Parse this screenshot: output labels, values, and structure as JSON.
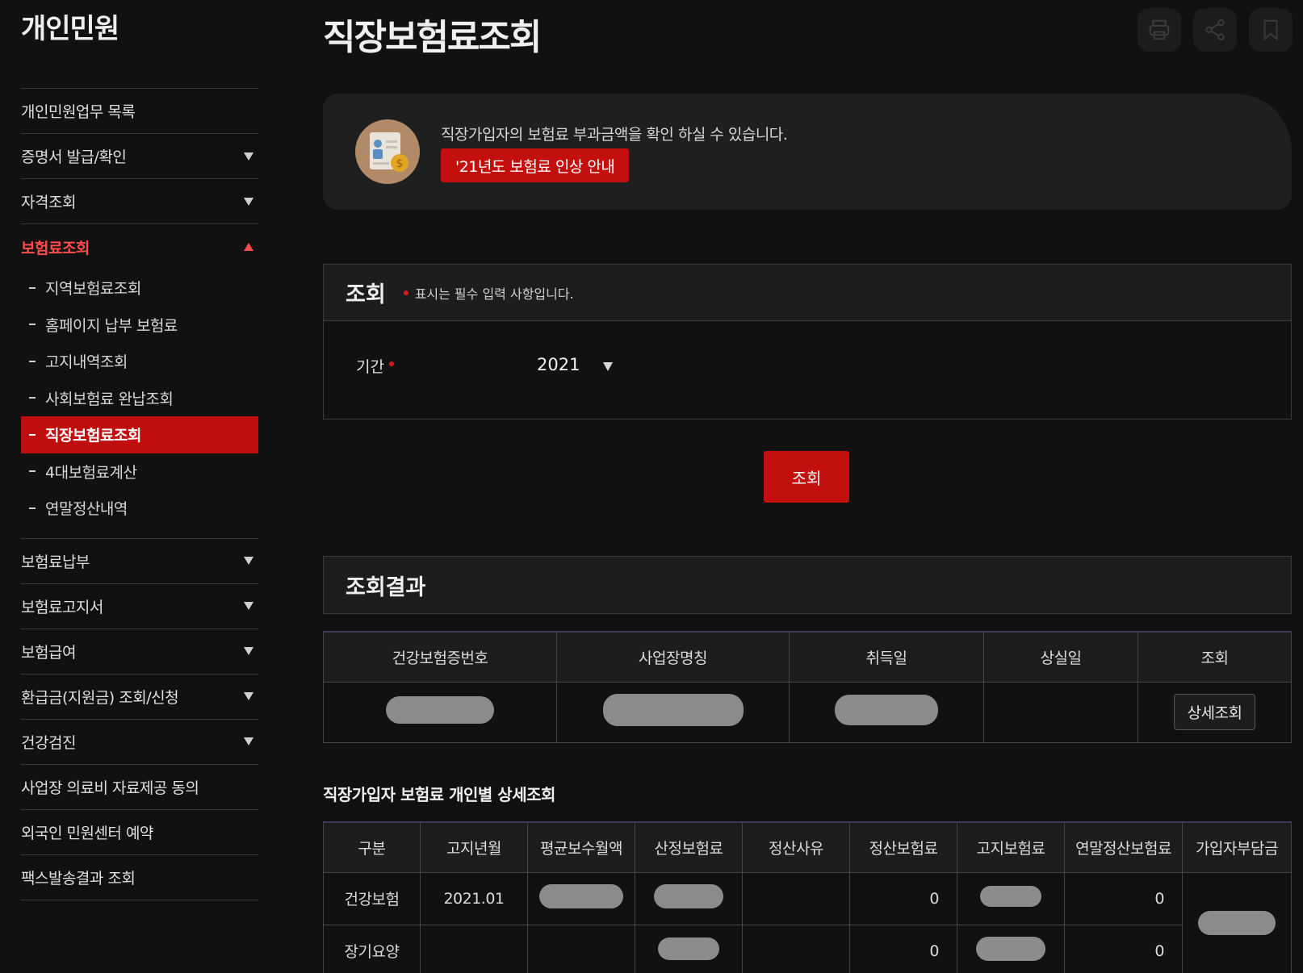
{
  "sidebar": {
    "title": "개인민원",
    "items": [
      {
        "label": "개인민원업무 목록"
      },
      {
        "label": "증명서 발급/확인"
      },
      {
        "label": "자격조회"
      },
      {
        "label": "보험료조회"
      },
      {
        "label": "보험료납부"
      },
      {
        "label": "보험료고지서"
      },
      {
        "label": "보험급여"
      },
      {
        "label": "환급금(지원금) 조회/신청"
      },
      {
        "label": "건강검진"
      },
      {
        "label": "사업장 의료비 자료제공 동의"
      },
      {
        "label": "외국인 민원센터 예약"
      },
      {
        "label": "팩스발송결과 조회"
      }
    ],
    "submenu": [
      {
        "label": "지역보험료조회"
      },
      {
        "label": "홈페이지 납부 보험료"
      },
      {
        "label": "고지내역조회"
      },
      {
        "label": "사회보험료 완납조회"
      },
      {
        "label": "직장보험료조회"
      },
      {
        "label": "4대보험료계산"
      },
      {
        "label": "연말정산내역"
      }
    ]
  },
  "header": {
    "title": "직장보험료조회",
    "tools": [
      "print-icon",
      "share-icon",
      "bookmark-icon"
    ]
  },
  "info": {
    "text": "직장가입자의 보험료 부과금액을 확인 하실 수 있습니다.",
    "button": "'21년도 보험료 인상 안내"
  },
  "query": {
    "title": "조회",
    "note": "표시는 필수 입력 사항입니다.",
    "period_label": "기간",
    "period_value": "2021",
    "search_button": "조회"
  },
  "result": {
    "title": "조회결과",
    "columns": [
      "건강보험증번호",
      "사업장명칭",
      "취득일",
      "상실일",
      "조회"
    ],
    "detail_button": "상세조회"
  },
  "detail": {
    "heading": "직장가입자 보험료 개인별 상세조회",
    "columns": [
      "구분",
      "고지년월",
      "평균보수월액",
      "산정보험료",
      "정산사유",
      "정산보험료",
      "고지보험료",
      "연말정산보험료",
      "가입자부담금"
    ],
    "rows": [
      {
        "type": "건강보험",
        "month": "2021.01",
        "settle_premium": "0",
        "year_end": "0"
      },
      {
        "type": "장기요양",
        "month": "",
        "settle_premium": "0",
        "year_end": "0"
      }
    ]
  },
  "colors": {
    "accent": "#c40f0f",
    "background": "#111112"
  }
}
